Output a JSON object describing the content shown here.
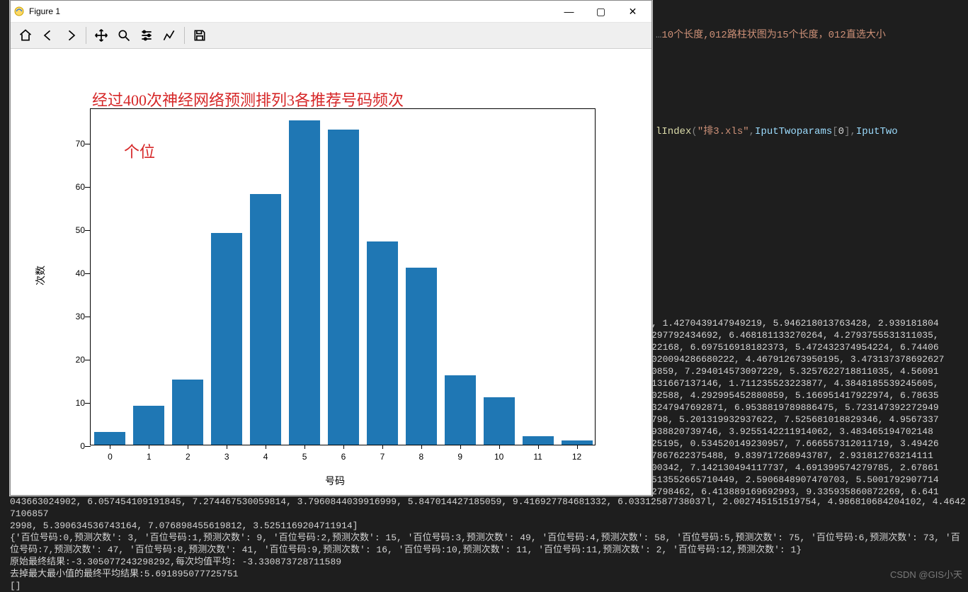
{
  "window": {
    "title": "Figure 1",
    "buttons": {
      "min": "—",
      "max": "▢",
      "close": "✕"
    }
  },
  "toolbar_icons": [
    "home",
    "back",
    "forward",
    "pan",
    "zoom",
    "configure",
    "subplots",
    "save"
  ],
  "chart_data": {
    "type": "bar",
    "title": "经过400次神经网络预测排列3各推荐号码频次",
    "annotation": "个位",
    "xlabel": "号码",
    "ylabel": "次数",
    "categories": [
      "0",
      "1",
      "2",
      "3",
      "4",
      "5",
      "6",
      "7",
      "8",
      "9",
      "10",
      "11",
      "12"
    ],
    "values": [
      3,
      9,
      15,
      49,
      58,
      75,
      73,
      47,
      41,
      16,
      11,
      2,
      1
    ],
    "ylim": [
      0,
      78
    ],
    "yticks": [
      0,
      10,
      20,
      30,
      40,
      50,
      60,
      70
    ]
  },
  "code_top": {
    "line1_tail": "10个长度,012路柱状图为15个长度，012直选大小",
    "line2": "lIndex(\"排3.xls\",IputTwoparams[0],IputTwo"
  },
  "console_right_lines": [
    ", 1.4270439147949219, 5.946218013763428, 2.939181804",
    "297792434692, 6.468181133270264, 4.2793755531311035,",
    "22168, 6.697516918182373, 5.472432374954224, 6.74406",
    "020094286680222, 4.467912673950195, 3.473137378692627",
    "0859, 7.294014573097229, 5.3257622718811035, 4.56091",
    "131667137146, 1.711235523223877, 4.3848185539245605,",
    "02588, 4.292995452880859, 5.166951417922974, 6.78635",
    "3247947692871, 6.9538819789886475, 5.723147392272949",
    "798, 5.201319932937622, 7.525681018829346, 4.9567337",
    "938820739746, 3.9255142211914062, 3.483465194702148",
    "25195, 0.534520149230957, 7.666557312011719, 3.49426",
    "7867622375488, 9.839717268943787, 2.931812763214111",
    "00342, 7.142130494117737, 4.691399574279785, 2.67861",
    "513552665710449, 2.5906848907470703, 5.5001792907714",
    "2798462, 6.413889169692993, 9.335935860872269, 6.641"
  ],
  "console_bottom_lines": [
    "043663024902, 6.057454109191845, 7.274467530059814, 3.7960844039916999, 5.847014427185059, 9.416927784681332, 6.03312587738037l, 2.002745151519754, 4.986810684204102, 4.46427106857",
    "2998, 5.390634536743164, 7.076898455619812, 3.5251169204711914]",
    "{'百位号码:0,预测次数': 3, '百位号码:1,预测次数': 9, '百位号码:2,预测次数': 15, '百位号码:3,预测次数': 49, '百位号码:4,预测次数': 58, '百位号码:5,预测次数': 75, '百位号码:6,预测次数': 73, '百位号码:7,预测次数': 47, '百位号码:8,预测次数': 41, '百位号码:9,预测次数': 16, '百位号码:10,预测次数': 11, '百位号码:11,预测次数': 2, '百位号码:12,预测次数': 1}",
    "原始最终结果:-3.305077243298292,每次均值平均: -3.330873728711589",
    "去掉最大最小值的最终平均结果:5.691895077725751",
    "[]"
  ],
  "watermark": "CSDN @GIS小天"
}
